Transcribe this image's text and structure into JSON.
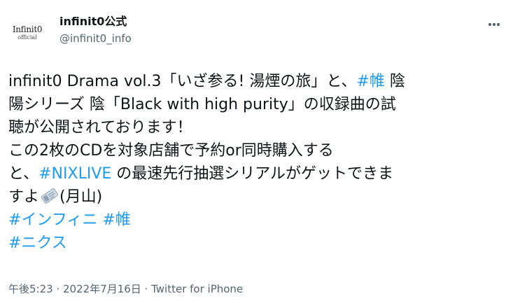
{
  "account": {
    "display_name": "infinit0公式",
    "handle": "@infinit0_info",
    "avatar_logo": "Infinit0",
    "avatar_sub": "official"
  },
  "tweet": {
    "line1_a": "infinit0 Drama vol.3「いざ参る! 湯煙の旅」と、",
    "line1_tag": "#帷",
    "line1_b": " 陰",
    "line2": "陽シリーズ 陰「Black with high purity」の収録曲の試",
    "line3": "聴が公開されております！",
    "line4": "この2枚のCDを対象店舗で予約or同時購入する",
    "line5_a": "と、",
    "line5_tag": "#NIXLIVE",
    "line5_b": " の最速先行抽選シリアルがゲットできま",
    "line6_a": "すよ",
    "line6_emoji": "ticket-icon",
    "line6_b": "(月山)",
    "line7_tag1": "#インフィニ",
    "line7_tag2": "#帷",
    "line8_tag": "#ニクス"
  },
  "meta": {
    "timestamp": "午後5:23 · 2022年7月16日 · Twitter for iPhone"
  },
  "colors": {
    "link": "#1d9bf0",
    "text": "#0f1419",
    "secondary": "#536471"
  }
}
